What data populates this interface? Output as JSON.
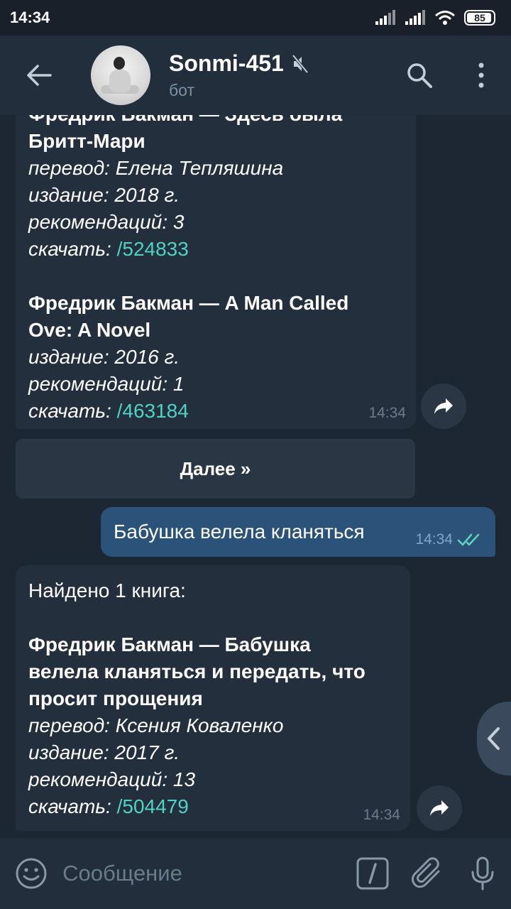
{
  "status_bar": {
    "time": "14:34",
    "battery": "85"
  },
  "header": {
    "title": "Sonmi-451",
    "subtitle": "бот"
  },
  "messages": {
    "results_1": {
      "book1_title_line1": "Фредрик Бакман — Здесь была",
      "book1_title_line2": "Бритт-Мари",
      "book1_translation": "перевод: Елена Тепляшина",
      "book1_edition": "издание: 2018 г.",
      "book1_recs": "рекомендаций: 3",
      "book1_download_label": "скачать: ",
      "book1_download_cmd": "/524833",
      "book2_title_line1": "Фредрик Бакман — A Man Called",
      "book2_title_line2": "Ove: A Novel",
      "book2_edition": "издание: 2016 г.",
      "book2_recs": "рекомендаций: 1",
      "book2_download_label": "скачать: ",
      "book2_download_cmd": "/463184",
      "time": "14:34"
    },
    "next_button": "Далее »",
    "outgoing": {
      "text": "Бабушка велела кланяться",
      "time": "14:34"
    },
    "results_2": {
      "found": "Найдено 1 книга:",
      "title_line1": "Фредрик Бакман — Бабушка",
      "title_line2": "велела кланяться и передать, что",
      "title_line3": "просит прощения",
      "translation": "перевод: Ксения Коваленко",
      "edition": "издание: 2017 г.",
      "recs": "рекомендаций: 13",
      "download_label": "скачать: ",
      "download_cmd": "/504479",
      "time": "14:34"
    }
  },
  "composer": {
    "placeholder": "Сообщение"
  },
  "colors": {
    "background": "#1d2733",
    "header": "#232e3c",
    "incoming_bubble": "#242f3d",
    "outgoing_bubble": "#2b5278",
    "command_link": "#4fd1c5",
    "read_checks": "#5fd3c0"
  },
  "icons": [
    "back-arrow-icon",
    "muted-icon",
    "search-icon",
    "more-vertical-icon",
    "share-icon",
    "double-check-icon",
    "chevron-left-icon",
    "emoji-icon",
    "bot-command-icon",
    "attach-icon",
    "microphone-icon",
    "signal-icon",
    "wifi-icon",
    "battery-icon"
  ]
}
